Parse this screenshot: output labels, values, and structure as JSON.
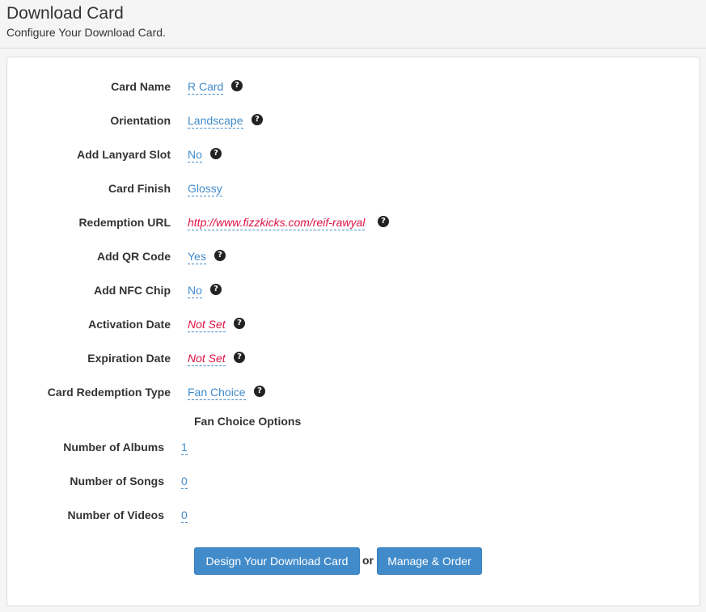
{
  "header": {
    "title": "Download Card",
    "subtitle": "Configure Your Download Card."
  },
  "fields": [
    {
      "label": "Card Name",
      "value": "R Card",
      "help_icon": "question-circle-icon"
    },
    {
      "label": "Orientation",
      "value": "Landscape",
      "help_icon": "question-circle-icon"
    },
    {
      "label": "Add Lanyard Slot",
      "value": "No",
      "help_icon": "question-circle-icon"
    },
    {
      "label": "Card Finish",
      "value": "Glossy"
    },
    {
      "label": "Redemption URL",
      "value": "http://www.fizzkicks.com/reif-rawyal",
      "help_icon": "question-circle-icon"
    },
    {
      "label": "Add QR Code",
      "value": "Yes",
      "help_icon": "question-circle-icon"
    },
    {
      "label": "Add NFC Chip",
      "value": "No",
      "help_icon": "question-circle-icon"
    },
    {
      "label": "Activation Date",
      "value": "Not Set",
      "help_icon": "question-circle-icon"
    },
    {
      "label": "Expiration Date",
      "value": "Not Set",
      "help_icon": "question-circle-icon"
    },
    {
      "label": "Card Redemption Type",
      "value": "Fan Choice",
      "help_icon": "question-circle-icon"
    }
  ],
  "fan_choice": {
    "title": "Fan Choice Options",
    "fields": [
      {
        "label": "Number of Albums",
        "value": "1"
      },
      {
        "label": "Number of Songs",
        "value": "0"
      },
      {
        "label": "Number of Videos",
        "value": "0"
      }
    ]
  },
  "actions": {
    "design_label": "Design Your Download Card",
    "or_label": "or",
    "manage_label": "Manage & Order"
  },
  "colors": {
    "link": "#428bca",
    "empty_value": "#dd1144",
    "button": "#428bca"
  }
}
